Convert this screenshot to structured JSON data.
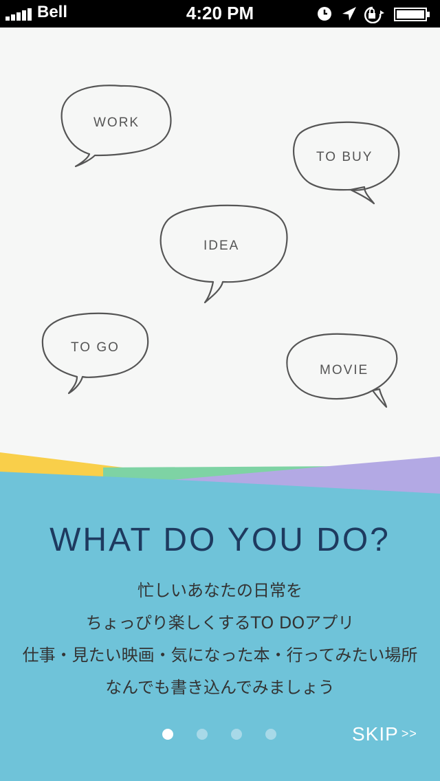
{
  "status_bar": {
    "carrier": "Bell",
    "time": "4:20 PM",
    "icons": [
      "signal-icon",
      "clock-icon",
      "location-arrow-icon",
      "rotation-lock-icon",
      "battery-icon"
    ]
  },
  "bubbles": [
    {
      "label": "WORK"
    },
    {
      "label": "TO BUY"
    },
    {
      "label": "IDEA"
    },
    {
      "label": "TO GO"
    },
    {
      "label": "MOVIE"
    }
  ],
  "headline": "WHAT DO YOU DO?",
  "description": [
    "忙しいあなたの日常を",
    "ちょっぴり楽しくするTO DOアプリ",
    "仕事・見たい映画・気になった本・行ってみたい場所",
    "なんでも書き込んでみましょう"
  ],
  "pager": {
    "count": 4,
    "active_index": 0
  },
  "skip": {
    "label": "SKIP",
    "arrows": ">>"
  },
  "colors": {
    "background_top": "#f6f7f6",
    "panel_blue": "#6fc3d9",
    "stripe_yellow": "#f9cf4a",
    "stripe_green": "#7ed3a4",
    "stripe_purple": "#b3a9e4",
    "headline": "#1e3a5f"
  }
}
